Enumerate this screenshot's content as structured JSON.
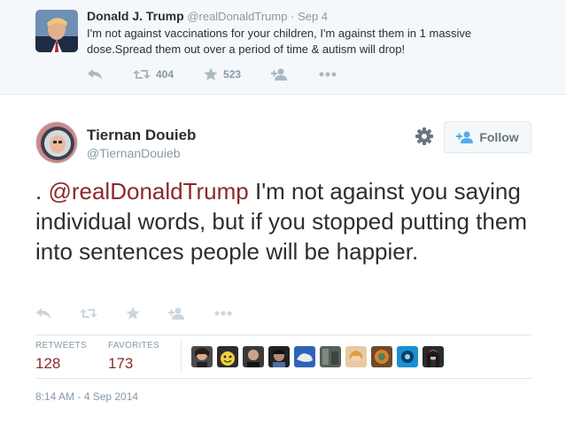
{
  "parent_tweet": {
    "name": "Donald J. Trump",
    "handle": "@realDonaldTrump",
    "separator": "·",
    "date": "Sep 4",
    "text": "I'm not against vaccinations for your children, I'm against them in 1 massive dose.Spread them out over a period of time & autism will drop!",
    "retweets": "404",
    "favorites": "523",
    "icons": [
      "reply-icon",
      "retweet-icon",
      "star-icon",
      "follow-icon",
      "more-icon"
    ]
  },
  "tweet": {
    "name": "Tiernan Douieb",
    "handle": "@TiernanDouieb",
    "follow_label": "Follow",
    "text_prefix": ". ",
    "mention": "@realDonaldTrump",
    "text_rest": " I'm not against you saying individual words, but if you stopped putting them into sentences people will be happier.",
    "retweets_label": "RETWEETS",
    "retweets_count": "128",
    "favorites_label": "FAVORITES",
    "favorites_count": "173",
    "timestamp": "8:14 AM - 4 Sep 2014",
    "favoriter_avatars": 9
  },
  "colors": {
    "accent_link": "#8b2a2a",
    "muted": "#8899a6",
    "icon": "#aab8c2",
    "text": "#292f33",
    "parent_bg": "#f5f8fa",
    "border": "#e1e8ed"
  }
}
